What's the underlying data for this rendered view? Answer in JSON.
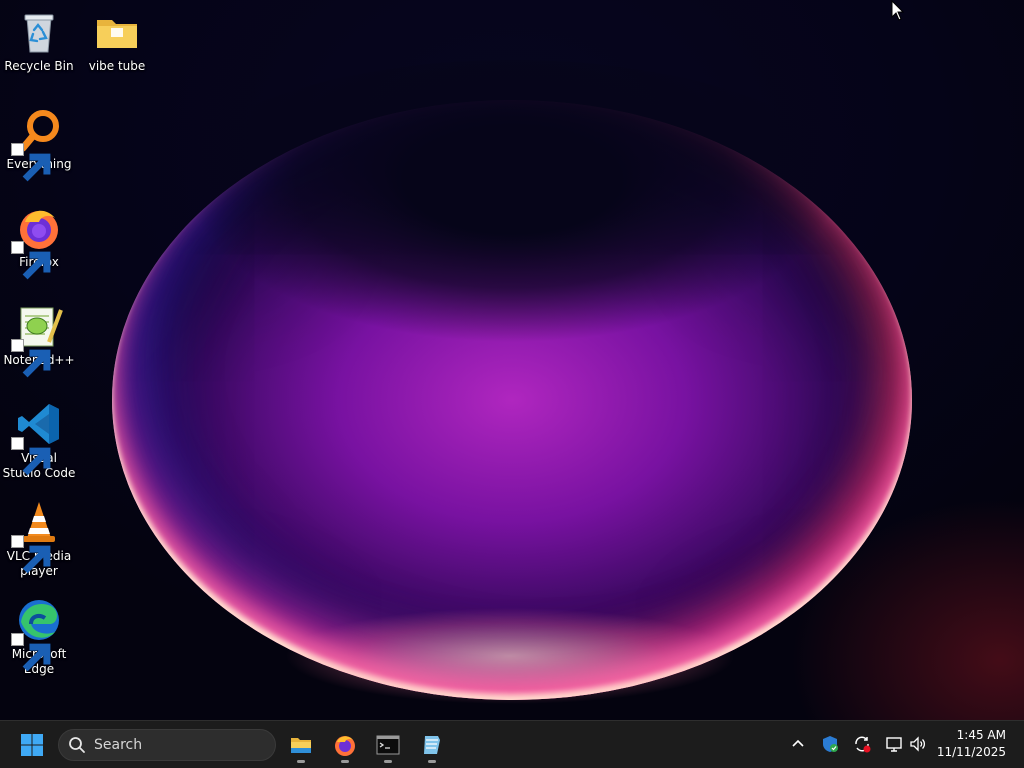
{
  "desktop": {
    "icons": [
      {
        "label": "Recycle Bin",
        "icon": "recycle-bin-icon",
        "shortcut": false
      },
      {
        "label": "vibe tube",
        "icon": "folder-icon",
        "shortcut": false
      },
      {
        "label": "Everything",
        "icon": "everything-search-icon",
        "shortcut": true
      },
      {
        "label": "Firefox",
        "icon": "firefox-icon",
        "shortcut": true
      },
      {
        "label": "Notepad++",
        "icon": "notepad-plus-plus-icon",
        "shortcut": true
      },
      {
        "label": "Visual Studio Code",
        "icon": "vscode-icon",
        "shortcut": true
      },
      {
        "label": "VLC media player",
        "icon": "vlc-icon",
        "shortcut": true
      },
      {
        "label": "Microsoft Edge",
        "icon": "edge-icon",
        "shortcut": true
      }
    ]
  },
  "taskbar": {
    "start_icon": "windows-start-icon",
    "search": {
      "placeholder": "Search",
      "icon": "search-icon"
    },
    "pinned": [
      {
        "name": "File Explorer",
        "icon": "file-explorer-icon",
        "running": true
      },
      {
        "name": "Firefox",
        "icon": "firefox-icon",
        "running": true
      },
      {
        "name": "Terminal",
        "icon": "terminal-icon",
        "running": true
      },
      {
        "name": "Notepad",
        "icon": "notepad-icon",
        "running": true
      }
    ],
    "tray": {
      "icons": [
        "chevron-up-icon",
        "windows-security-icon",
        "sync-icon",
        "network-icon",
        "volume-icon"
      ],
      "time": "1:45 AM",
      "date": "11/11/2025"
    }
  },
  "colors": {
    "taskbar_bg": "#1c1c1c",
    "accent": "#0078d4",
    "wallpaper_primary": "#b428c8"
  }
}
